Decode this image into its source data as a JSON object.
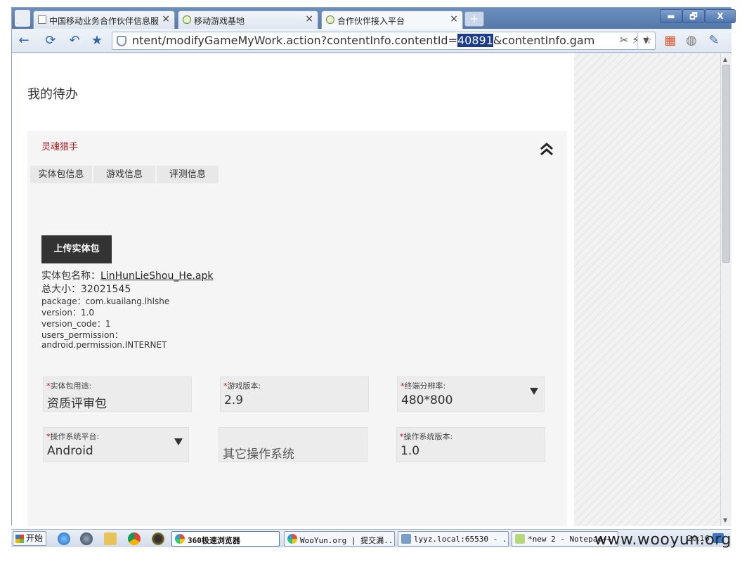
{
  "browser": {
    "tabs": [
      {
        "label": "中国移动业务合作伙伴信息服",
        "close": "×"
      },
      {
        "label": "移动游戏基地",
        "close": "×"
      },
      {
        "label": "合作伙伴接入平台",
        "close": "×"
      }
    ],
    "new_tab": "+",
    "window_controls": {
      "minimize": "▬",
      "restore": "🗗",
      "close": "X"
    },
    "url_prefix": "ntent/modifyGameMyWork.action?contentInfo.contentId=",
    "url_highlight": "40891",
    "url_suffix": "&contentInfo.gam",
    "url_icons": "✂ ⚡ ☆"
  },
  "page": {
    "title": "我的待办",
    "game_name": "灵魂猎手",
    "subtabs": [
      "实体包信息",
      "游戏信息",
      "评测信息"
    ],
    "upload_button": "上传实体包",
    "package": {
      "name_label": "实体包名称：",
      "name_value": "LinHunLieShou_He.apk",
      "size_line": "总大小：32021545",
      "package_line": "package：com.kuailang.lhlshe",
      "version_line": "version：1.0",
      "version_code_line": "version_code：1",
      "permission_label": "users_permission：",
      "permission_value": "android.permission.INTERNET"
    },
    "fields": {
      "usage": {
        "label": "实体包用途:",
        "value": "资质评审包"
      },
      "game_version": {
        "label": "游戏版本:",
        "value": "2.9"
      },
      "resolution": {
        "label": "终端分辨率:",
        "value": "480*800"
      },
      "os_platform": {
        "label": "操作系统平台:",
        "value": "Android"
      },
      "other_os": {
        "label": "",
        "value": "其它操作系统"
      },
      "os_version": {
        "label": "操作系统版本:",
        "value": "1.0"
      }
    },
    "required_mark": "*"
  },
  "taskbar": {
    "start": "开始",
    "items": [
      "360极速浏览器",
      "WooYun.org | 提交漏...",
      "lyyz.local:65530 - ...",
      "*new  2 - Notepad++"
    ],
    "clock": "20:16"
  },
  "watermark": "www.wooyun.org",
  "colors": {
    "game_name": "#b01a1a",
    "upload_button": "#333333",
    "required": "#cc0000",
    "url_highlight": "#1b3c8a"
  }
}
